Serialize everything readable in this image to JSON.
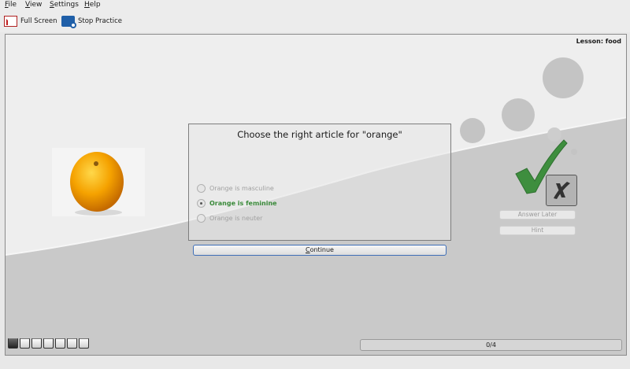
{
  "menu": [
    {
      "label": "File",
      "mnemonic": "F",
      "rest": "ile"
    },
    {
      "label": "View",
      "mnemonic": "V",
      "rest": "iew"
    },
    {
      "label": "Settings",
      "mnemonic": "S",
      "rest": "ettings"
    },
    {
      "label": "Help",
      "mnemonic": "H",
      "rest": "elp"
    }
  ],
  "toolbar": {
    "full_screen": {
      "label": "Full Screen",
      "icon": "full-screen-icon"
    },
    "stop_practice": {
      "label": "Stop Practice",
      "icon": "stop-practice-icon"
    }
  },
  "lesson": "Lesson: food",
  "question": "Choose the right article for \"orange\"",
  "options": [
    {
      "label": "Orange is masculine",
      "selected": false
    },
    {
      "label": "Orange is feminine",
      "selected": true,
      "correct": true
    },
    {
      "label": "Orange is neuter",
      "selected": false
    }
  ],
  "continue_button": {
    "mnemonic": "C",
    "rest": "ontinue"
  },
  "answer_later_button": "Answer Later",
  "hint_button": "Hint",
  "progress": {
    "text": "0/4",
    "fraction": 0.0
  },
  "tray_slots": 7,
  "colors": {
    "correct_green": "#3a8a3a",
    "check_green": "#3e8e3e",
    "focus_blue": "#3f6fb8"
  },
  "image": {
    "subject": "orange fruit"
  }
}
